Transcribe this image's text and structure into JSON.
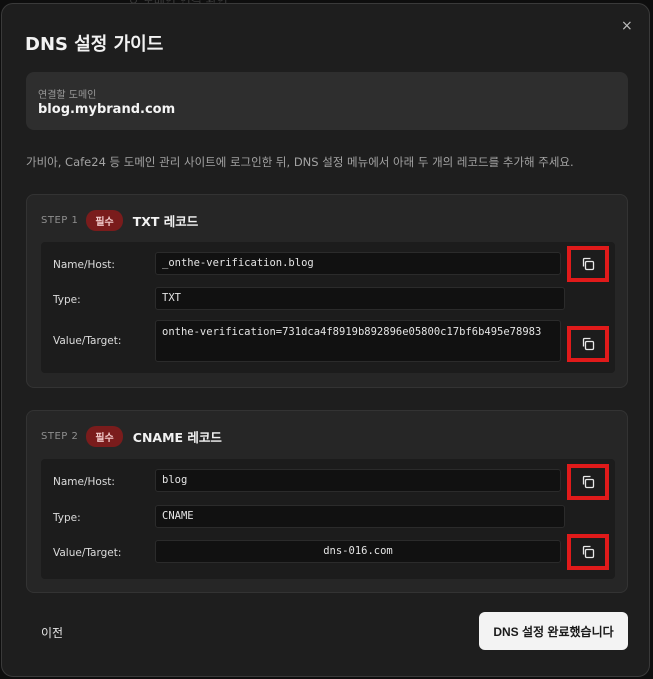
{
  "backdrop_text": "ㅇ 도메인 연결 확인",
  "dialog": {
    "title": "DNS 설정 가이드",
    "close_label": "×"
  },
  "domain": {
    "label": "연결할 도메인",
    "value": "blog.mybrand.com"
  },
  "instruction": "가비아, Cafe24 등 도메인 관리 사이트에 로그인한 뒤, DNS 설정 메뉴에서 아래 두 개의 레코드를 추가해 주세요.",
  "steps": [
    {
      "step_label": "STEP 1",
      "badge": "필수",
      "title": "TXT 레코드",
      "name_label": "Name/Host:",
      "name_value": "_onthe-verification.blog",
      "type_label": "Type:",
      "type_value": "TXT",
      "target_label": "Value/Target:",
      "target_value": "onthe-verification=731dca4f8919b892896e05800c17bf6b495e78983"
    },
    {
      "step_label": "STEP 2",
      "badge": "필수",
      "title": "CNAME 레코드",
      "name_label": "Name/Host:",
      "name_value": "blog",
      "type_label": "Type:",
      "type_value": "CNAME",
      "target_label": "Value/Target:",
      "target_value": "dns-016.com"
    }
  ],
  "footer": {
    "back_label": "이전",
    "done_label": "DNS 설정 완료했습니다"
  },
  "icons": {
    "copy": "copy-icon",
    "close": "close-icon"
  },
  "colors": {
    "badge_bg": "#7a1c1c",
    "highlight_border": "#e01a1a"
  }
}
